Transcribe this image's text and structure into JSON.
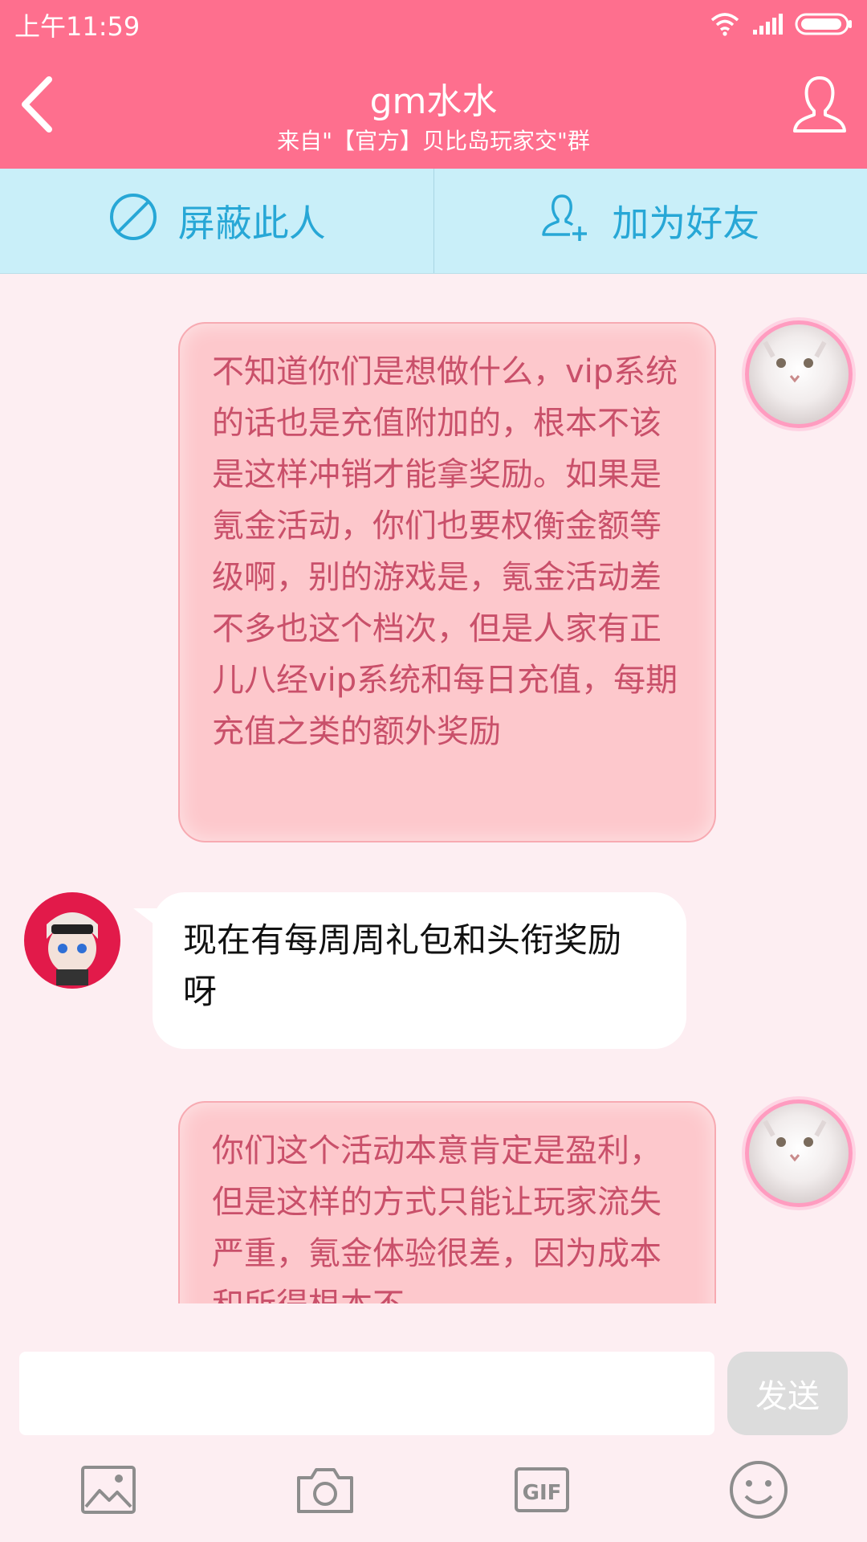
{
  "status": {
    "time": "上午11:59"
  },
  "header": {
    "title": "gm水水",
    "subtitle": "来自\"【官方】贝比岛玩家交\"群"
  },
  "actions": {
    "block_label": "屏蔽此人",
    "add_friend_label": "加为好友"
  },
  "messages": [
    {
      "side": "right",
      "text": "不知道你们是想做什么，vip系统的话也是充值附加的，根本不该是这样冲销才能拿奖励。如果是氪金活动，你们也要权衡金额等级啊，别的游戏是，氪金活动差不多也这个档次，但是人家有正儿八经vip系统和每日充值，每期充值之类的额外奖励"
    },
    {
      "side": "left",
      "text": "现在有每周周礼包和头衔奖励呀"
    },
    {
      "side": "right",
      "text": "你们这个活动本意肯定是盈利，但是这样的方式只能让玩家流失严重，氪金体验很差，因为成本和所得根本不"
    }
  ],
  "composer": {
    "placeholder": "",
    "send_label": "发送"
  },
  "colors": {
    "header": "#fe6f8e",
    "action_bar": "#c9eff9",
    "accent_blue": "#27a7d6",
    "bubble_pink": "#fdc8cc",
    "bubble_pink_text": "#c9506a",
    "background": "#fdeef2"
  },
  "icons": {
    "back": "chevron-left-icon",
    "profile": "user-icon",
    "block": "block-icon",
    "add_friend": "add-user-icon",
    "image": "image-icon",
    "camera": "camera-icon",
    "gif": "gif-icon",
    "emoji": "smiley-icon"
  }
}
